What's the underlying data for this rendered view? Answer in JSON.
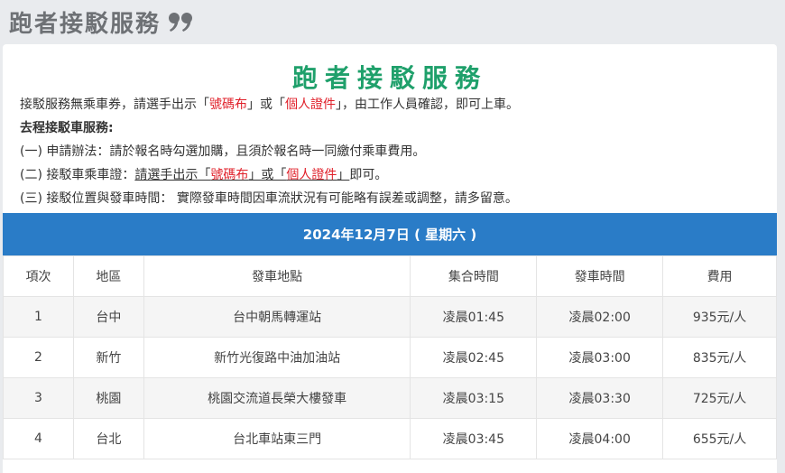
{
  "header": {
    "title": "跑者接駁服務"
  },
  "card": {
    "title": "跑者接駁服務",
    "intro": {
      "l1_a": "接駁服務無乘車券，請選手出示「",
      "l1_red1": "號碼布",
      "l1_b": "」或「",
      "l1_red2": "個人證件",
      "l1_c": "」，由工作人員確認，即可上車。",
      "l2": "去程接駁車服務:",
      "l3": "(一) 申請辦法：請於報名時勾選加購，且須於報名時一同繳付乘車費用。",
      "l4_a": "(二) 接駁車乘車證：",
      "l4_u1": "請選手出示「",
      "l4_red1": "號碼布",
      "l4_u2": "」或「",
      "l4_red2": "個人證件",
      "l4_u3": "」",
      "l4_b": "即可。",
      "l5": "(三) 接駁位置與發車時間： 實際發車時間因車流狀況有可能略有誤差或調整，請多留意。"
    },
    "banner": "2024年12月7日 ( 星期六 )"
  },
  "table": {
    "headers": [
      "項次",
      "地區",
      "發車地點",
      "集合時間",
      "發車時間",
      "費用"
    ],
    "rows": [
      [
        "1",
        "台中",
        "台中朝馬轉運站",
        "凌晨01:45",
        "凌晨02:00",
        "935元/人"
      ],
      [
        "2",
        "新竹",
        "新竹光復路中油加油站",
        "凌晨02:45",
        "凌晨03:00",
        "835元/人"
      ],
      [
        "3",
        "桃園",
        "桃園交流道長榮大樓發車",
        "凌晨03:15",
        "凌晨03:30",
        "725元/人"
      ],
      [
        "4",
        "台北",
        "台北車站東三門",
        "凌晨03:45",
        "凌晨04:00",
        "655元/人"
      ]
    ]
  },
  "colors": {
    "accent_green": "#1fa06b",
    "banner_blue": "#2a7cc7",
    "highlight_red": "#e0202a"
  },
  "icons": {
    "header": "quote-icon"
  }
}
